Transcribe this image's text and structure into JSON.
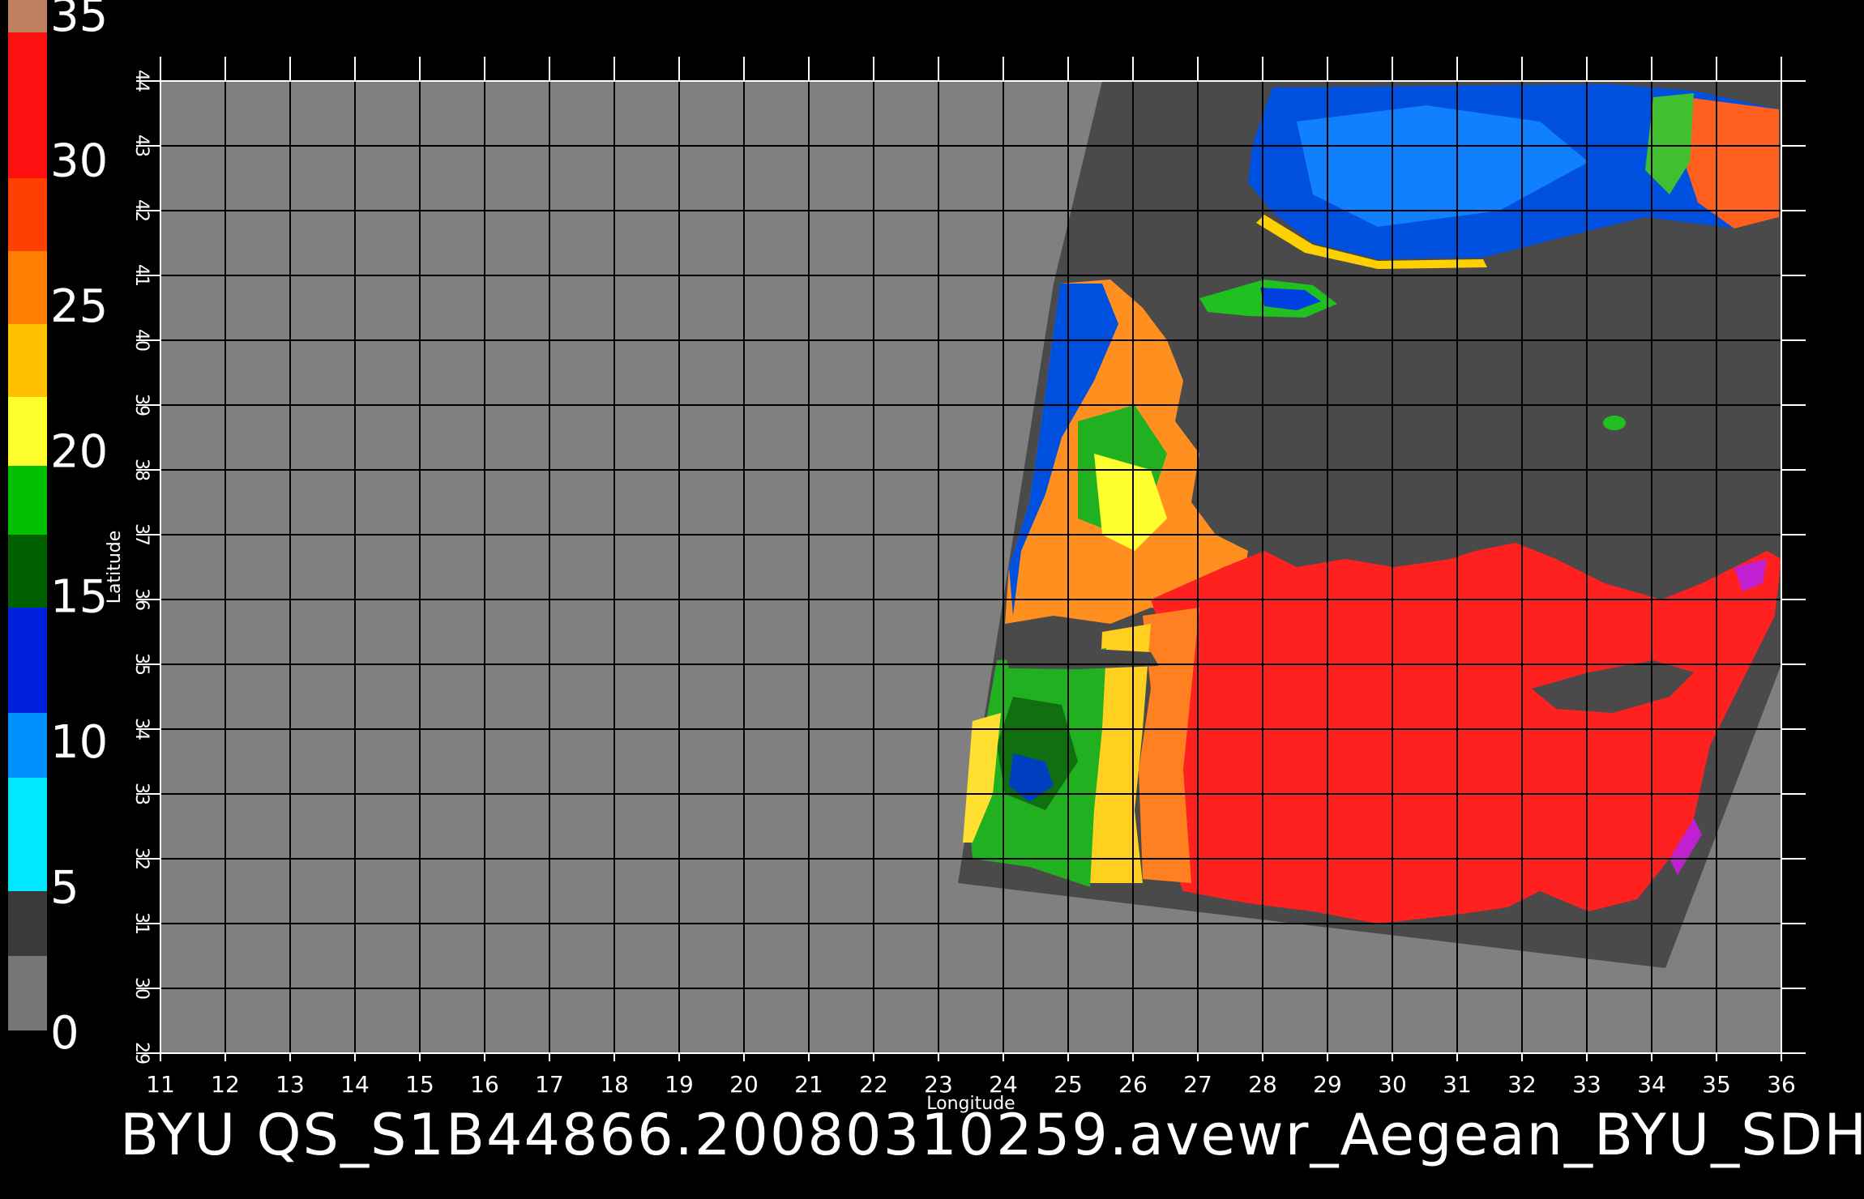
{
  "title": "BYU QS_S1B44866.20080310259.avewr_Aegean_BYU_SDH",
  "colors": {
    "background": "#000000",
    "land": "#808080",
    "swath_land": "#4a4a4a",
    "grid": "#000000",
    "axis": "#ffffff"
  },
  "axes": {
    "x_label": "Longitude",
    "y_label": "Latitude",
    "x_ticks": [
      "11",
      "12",
      "13",
      "14",
      "15",
      "16",
      "17",
      "18",
      "19",
      "20",
      "21",
      "22",
      "23",
      "24",
      "25",
      "26",
      "27",
      "28",
      "29",
      "30",
      "31",
      "32",
      "33",
      "34",
      "35",
      "36"
    ],
    "y_ticks": [
      "29",
      "30",
      "31",
      "32",
      "33",
      "34",
      "35",
      "36",
      "37",
      "38",
      "39",
      "40",
      "41",
      "42",
      "43",
      "44"
    ],
    "x_range": [
      11,
      36
    ],
    "y_range": [
      29,
      44
    ]
  },
  "color_scale": {
    "labels": [
      "0",
      "5",
      "10",
      "15",
      "20",
      "25",
      "30",
      "35"
    ],
    "range": [
      0,
      35
    ],
    "colors": [
      "#777777",
      "#555555",
      "#333333",
      "#00e8ff",
      "#0090ff",
      "#0020e0",
      "#006000",
      "#00c000",
      "#ffff30",
      "#ffc000",
      "#ff7000",
      "#ff4000",
      "#ff1010",
      "#ff2020",
      "#c08060"
    ]
  }
}
